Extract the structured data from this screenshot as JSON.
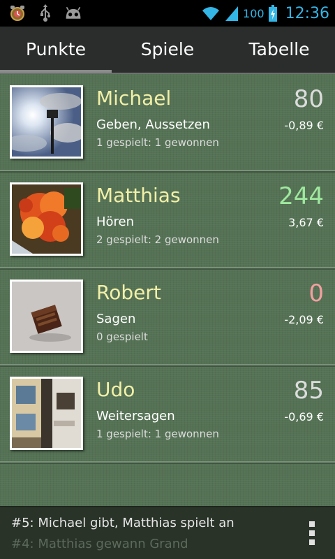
{
  "status_bar": {
    "icons_left": [
      "alarm-icon",
      "usb-icon",
      "android-icon"
    ],
    "battery": "100",
    "time": "12:36"
  },
  "tabs": [
    {
      "label": "Punkte",
      "active": true
    },
    {
      "label": "Spiele",
      "active": false
    },
    {
      "label": "Tabelle",
      "active": false
    }
  ],
  "players": [
    {
      "name": "Michael",
      "action": "Geben, Aussetzen",
      "stats": "1 gespielt: 1 gewonnen",
      "points": "80",
      "points_color": "#dcdcdc",
      "money": "-0,89 €"
    },
    {
      "name": "Matthias",
      "action": "Hören",
      "stats": "2 gespielt: 2 gewonnen",
      "points": "244",
      "points_color": "#9fe89f",
      "money": "3,67 €"
    },
    {
      "name": "Robert",
      "action": "Sagen",
      "stats": "0 gespielt",
      "points": "0",
      "points_color": "#f2a0a0",
      "money": "-2,09 €"
    },
    {
      "name": "Udo",
      "action": "Weitersagen",
      "stats": "1 gespielt: 1 gewonnen",
      "points": "85",
      "points_color": "#dcdcdc",
      "money": "-0,69 €"
    }
  ],
  "log": {
    "line1": "#5: Michael gibt, Matthias spielt an",
    "line2": "#4: Matthias gewann Grand"
  },
  "colors": {
    "accent": "#33b5e5",
    "name": "#f2f0a8",
    "felt": "#557255"
  }
}
